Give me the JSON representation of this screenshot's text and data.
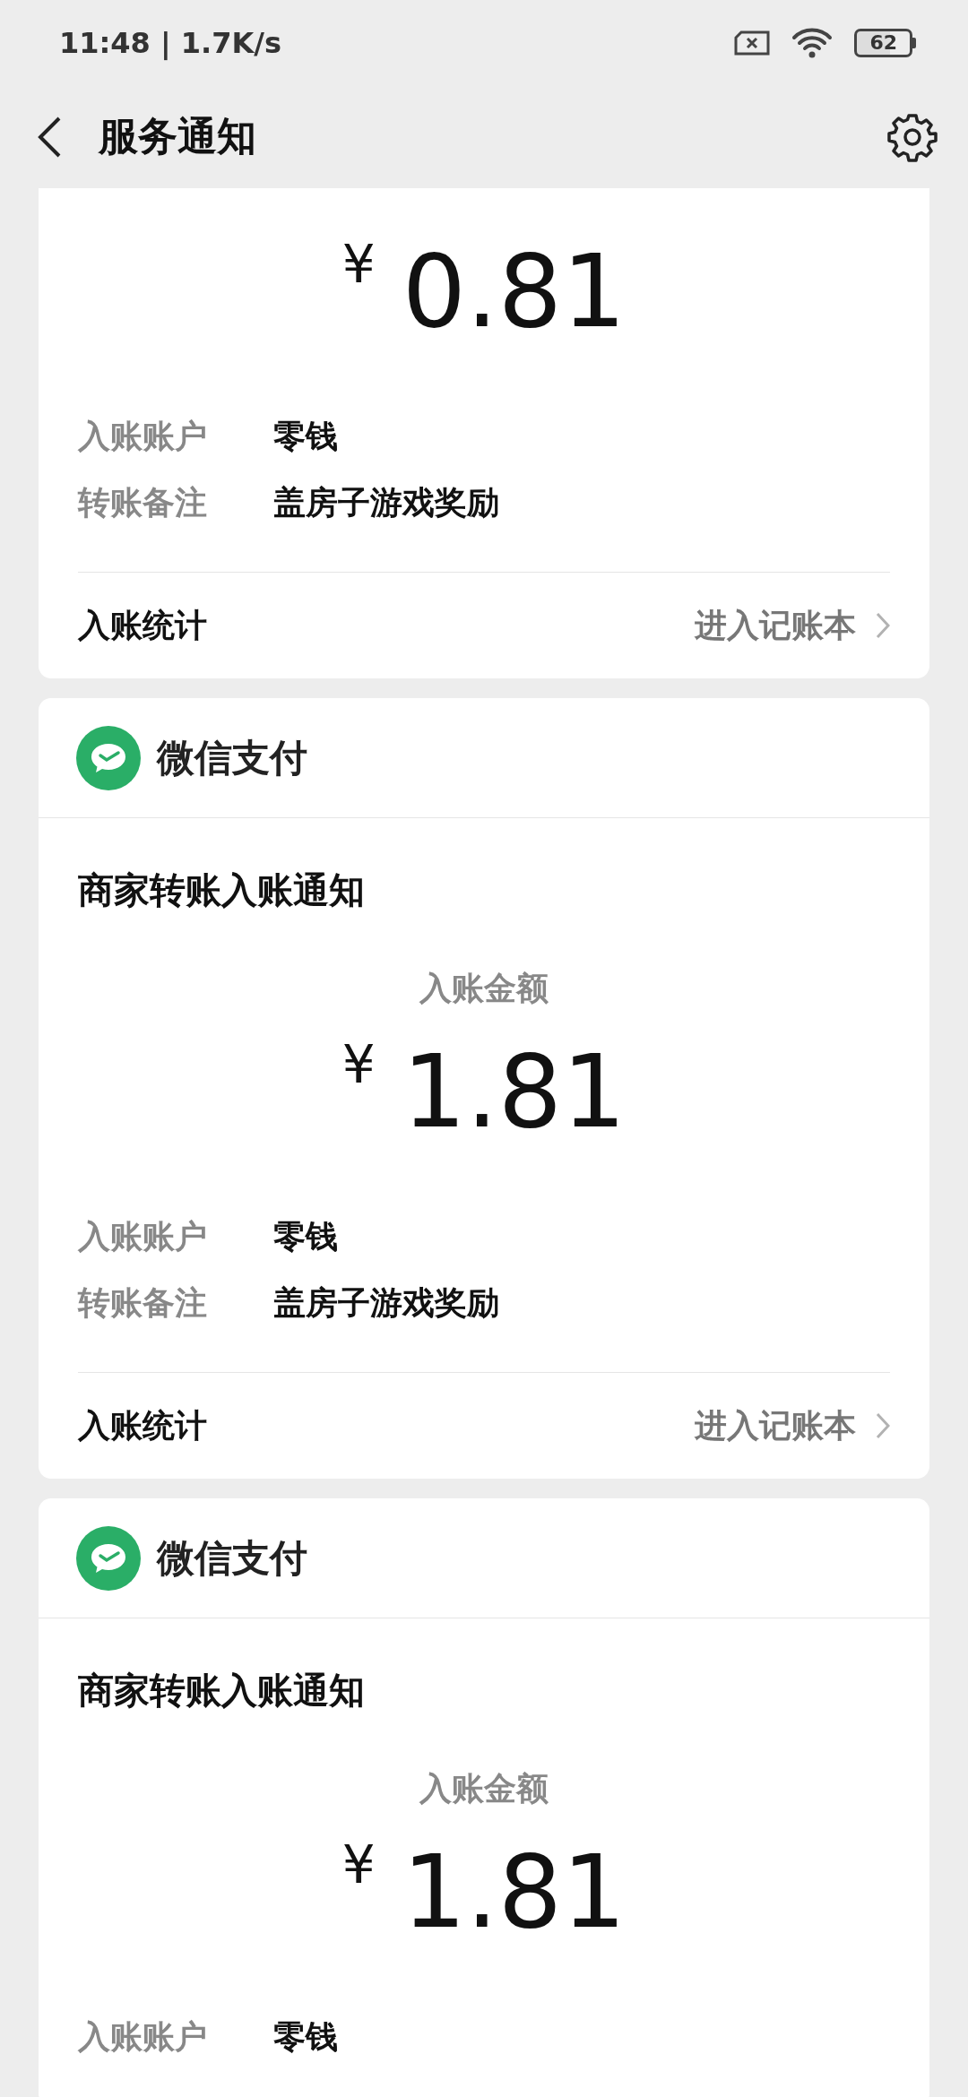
{
  "status_bar": {
    "time": "11:48 | 1.7K/s",
    "battery": "62"
  },
  "header": {
    "title": "服务通知"
  },
  "cards": [
    {
      "currency": "¥",
      "amount": "0.81",
      "details": [
        {
          "label": "入账账户",
          "value": "零钱"
        },
        {
          "label": "转账备注",
          "value": "盖房子游戏奖励"
        }
      ],
      "footer": {
        "label": "入账统计",
        "link": "进入记账本"
      }
    },
    {
      "source": "微信支付",
      "title": "商家转账入账通知",
      "amount_label": "入账金额",
      "currency": "¥",
      "amount": "1.81",
      "details": [
        {
          "label": "入账账户",
          "value": "零钱"
        },
        {
          "label": "转账备注",
          "value": "盖房子游戏奖励"
        }
      ],
      "footer": {
        "label": "入账统计",
        "link": "进入记账本"
      }
    },
    {
      "source": "微信支付",
      "title": "商家转账入账通知",
      "amount_label": "入账金额",
      "currency": "¥",
      "amount": "1.81",
      "details": [
        {
          "label": "入账账户",
          "value": "零钱"
        }
      ]
    }
  ]
}
